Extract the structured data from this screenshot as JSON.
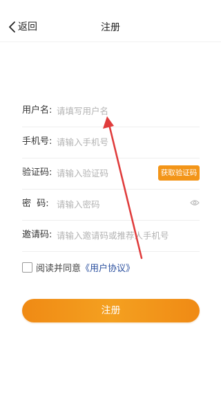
{
  "navbar": {
    "back_label": "返回",
    "title": "注册"
  },
  "form": {
    "username": {
      "label": "用户名:",
      "placeholder": "请填写用户名"
    },
    "phone": {
      "label": "手机号:",
      "placeholder": "请输入手机号"
    },
    "code": {
      "label": "验证码:",
      "placeholder": "请输入验证码",
      "button": "获取验证码"
    },
    "password": {
      "label": "密  码:",
      "placeholder": "请输入密码"
    },
    "invite": {
      "label": "邀请码:",
      "placeholder": "请输入邀请码或推荐人手机号"
    }
  },
  "agreement": {
    "text": "阅读并同意",
    "link": "《用户协议》",
    "checked": false
  },
  "submit_label": "注册",
  "colors": {
    "accent": "#f39518",
    "link": "#2a4f9e",
    "annotation": "#e03c3c"
  },
  "icons": {
    "back": "chevron-left-icon",
    "password_visibility": "eye-icon",
    "annotation": "red-arrow"
  }
}
